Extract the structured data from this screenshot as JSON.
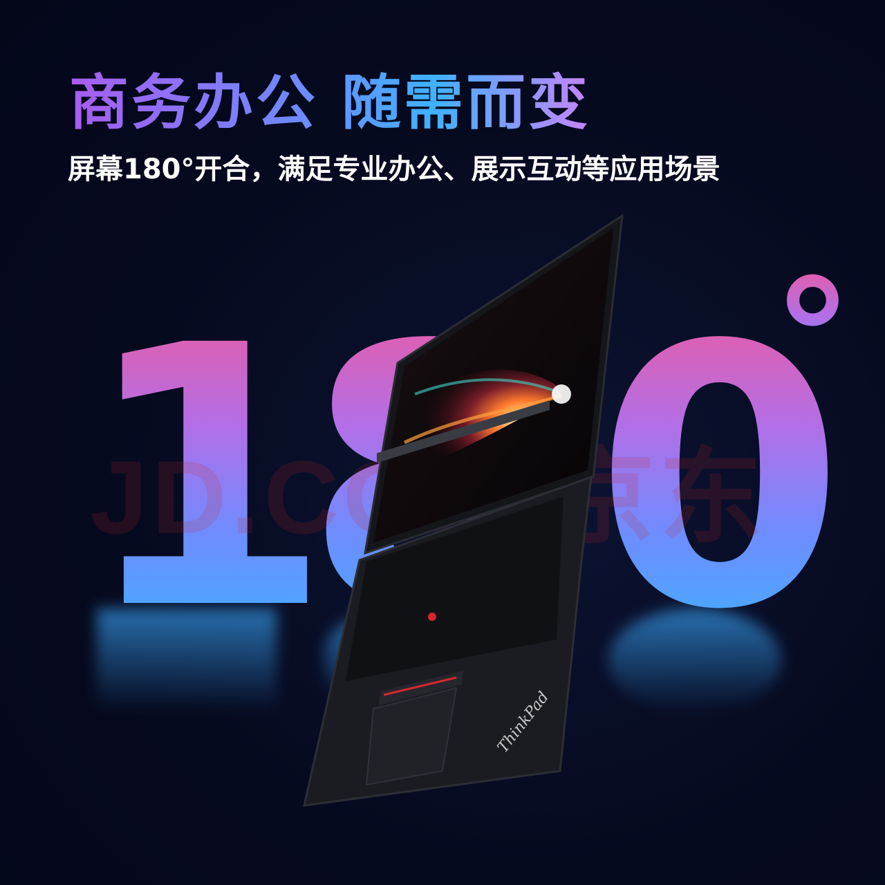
{
  "headline": "商务办公 随需而变",
  "subheadline": "屏幕180°开合，满足专业办公、展示互动等应用场景",
  "hero_number": {
    "d1": "1",
    "d2": "8",
    "d3": "0",
    "degree": "°"
  },
  "watermark": "JD.COM 京东",
  "laptop": {
    "brand": "ThinkPad"
  },
  "colors": {
    "background": "#060a1f",
    "gradient_pink": "#ec5ba0",
    "gradient_purple": "#b36ee6",
    "gradient_blue": "#3cb4ff",
    "trackpoint_red": "#d8262e"
  }
}
